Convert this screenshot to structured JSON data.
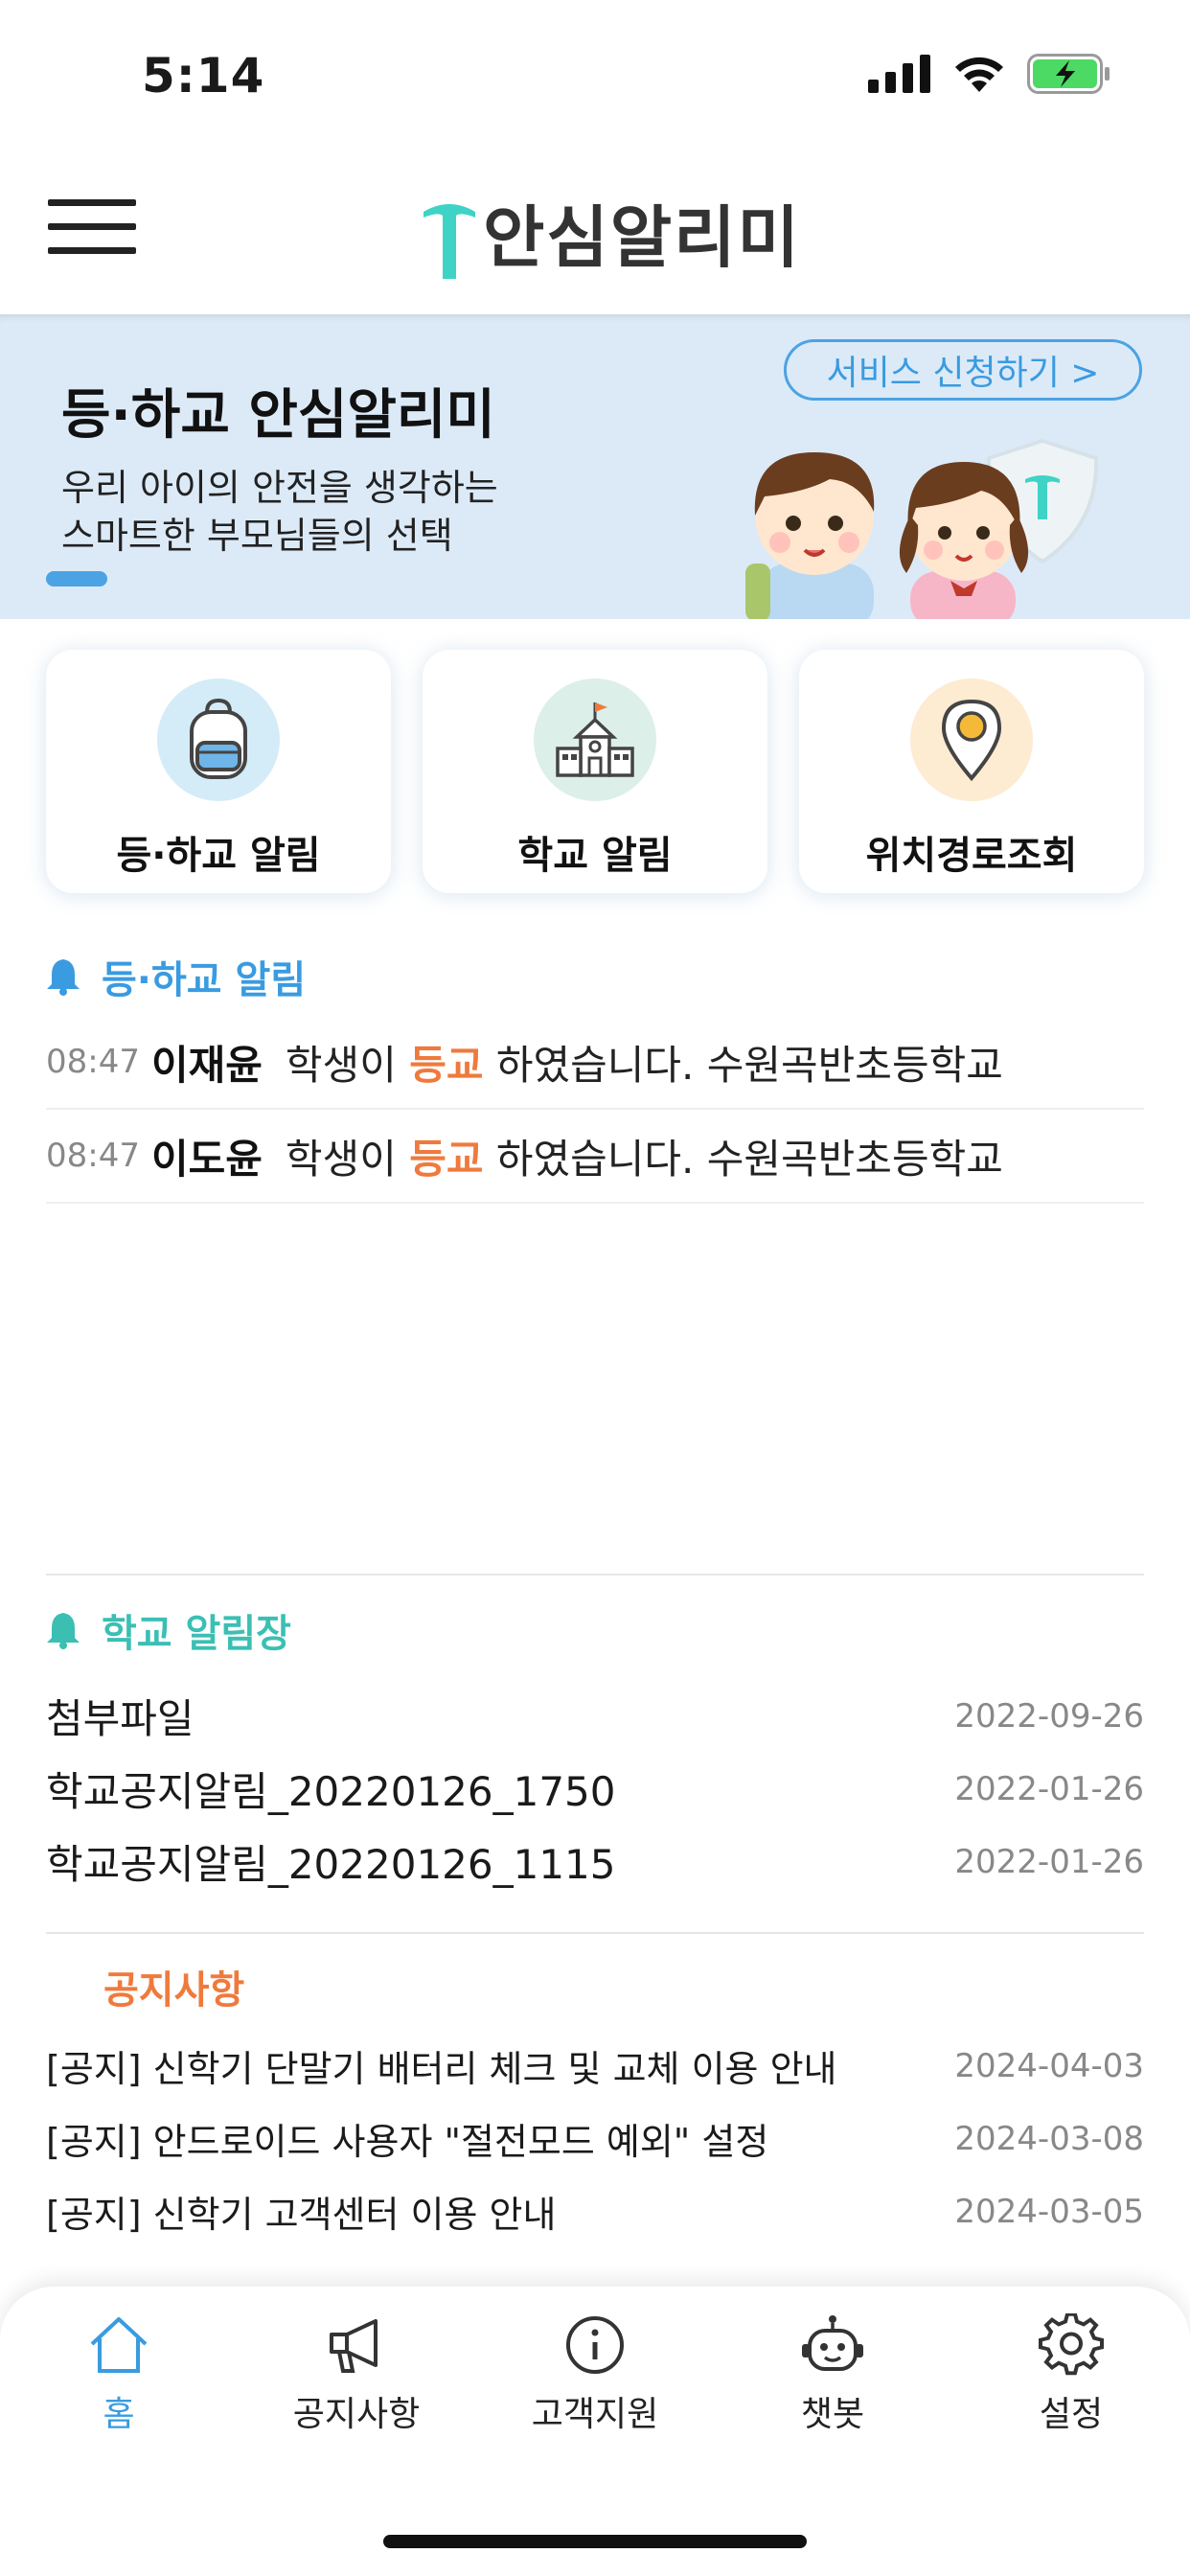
{
  "status_bar": {
    "time": "5:14",
    "icons": [
      "signal-icon",
      "wifi-icon",
      "battery-charging-icon"
    ],
    "battery_color": "#4cd964"
  },
  "header": {
    "logo_text": "안심알리미",
    "logo_mark": "T",
    "logo_color": "#3fd3c6"
  },
  "banner": {
    "title": "등·하교 안심알리미",
    "subtitle_line1": "우리 아이의 안전을 생각하는",
    "subtitle_line2": "스마트한 부모님들의 선택",
    "service_button": "서비스 신청하기 >",
    "background_color": "#dceaf8"
  },
  "quick_menu": [
    {
      "label": "등·하교 알림",
      "icon": "backpack-icon",
      "icon_bg": "#d4ecf8"
    },
    {
      "label": "학교 알림",
      "icon": "school-icon",
      "icon_bg": "#dcefe9"
    },
    {
      "label": "위치경로조회",
      "icon": "location-pin-icon",
      "icon_bg": "#fdebd2"
    }
  ],
  "commute_alerts": {
    "title": "등·하교 알림",
    "title_color": "#3a9be0",
    "items": [
      {
        "time": "08:47",
        "name": "이재윤",
        "pre": "학생이",
        "status": "등교",
        "post": "하였습니다. 수원곡반초등학교"
      },
      {
        "time": "08:47",
        "name": "이도윤",
        "pre": "학생이",
        "status": "등교",
        "post": "하였습니다. 수원곡반초등학교"
      }
    ]
  },
  "school_notices": {
    "title": "학교 알림장",
    "title_color": "#3bbfb3",
    "items": [
      {
        "title": "첨부파일",
        "date": "2022-09-26"
      },
      {
        "title": "학교공지알림_20220126_1750",
        "date": "2022-01-26"
      },
      {
        "title": "학교공지알림_20220126_1115",
        "date": "2022-01-26"
      }
    ]
  },
  "announcements": {
    "title": "공지사항",
    "title_color": "#ef7a3c",
    "items": [
      {
        "title": "[공지] 신학기 단말기 배터리 체크 및 교체 이용 안내",
        "date": "2024-04-03"
      },
      {
        "title": "[공지] 안드로이드 사용자 \"절전모드 예외\" 설정",
        "date": "2024-03-08"
      },
      {
        "title": "[공지] 신학기 고객센터 이용 안내",
        "date": "2024-03-05"
      }
    ]
  },
  "tab_bar": {
    "active": "홈",
    "active_color": "#3a9be0",
    "tabs": [
      {
        "label": "홈",
        "icon": "home-icon"
      },
      {
        "label": "공지사항",
        "icon": "megaphone-icon"
      },
      {
        "label": "고객지원",
        "icon": "info-icon"
      },
      {
        "label": "챗봇",
        "icon": "robot-icon"
      },
      {
        "label": "설정",
        "icon": "gear-icon"
      }
    ]
  }
}
